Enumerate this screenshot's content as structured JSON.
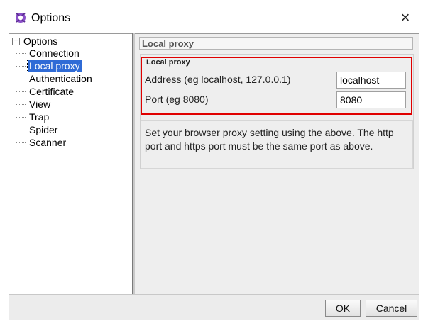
{
  "window": {
    "title": "Options"
  },
  "tree": {
    "root": "Options",
    "items": [
      {
        "label": "Connection",
        "selected": false
      },
      {
        "label": "Local proxy",
        "selected": true
      },
      {
        "label": "Authentication",
        "selected": false
      },
      {
        "label": "Certificate",
        "selected": false
      },
      {
        "label": "View",
        "selected": false
      },
      {
        "label": "Trap",
        "selected": false
      },
      {
        "label": "Spider",
        "selected": false
      },
      {
        "label": "Scanner",
        "selected": false
      }
    ]
  },
  "panel": {
    "title": "Local proxy",
    "group_label": "Local proxy",
    "address_label": "Address (eg localhost, 127.0.0.1)",
    "address_value": "localhost",
    "port_label": "Port (eg 8080)",
    "port_value": "8080",
    "help_text": "Set your browser proxy setting using the above. The http port and https port must be the same port as above."
  },
  "buttons": {
    "ok": "OK",
    "cancel": "Cancel"
  },
  "colors": {
    "selection": "#2f6bd6",
    "highlight_box": "#e00000"
  }
}
